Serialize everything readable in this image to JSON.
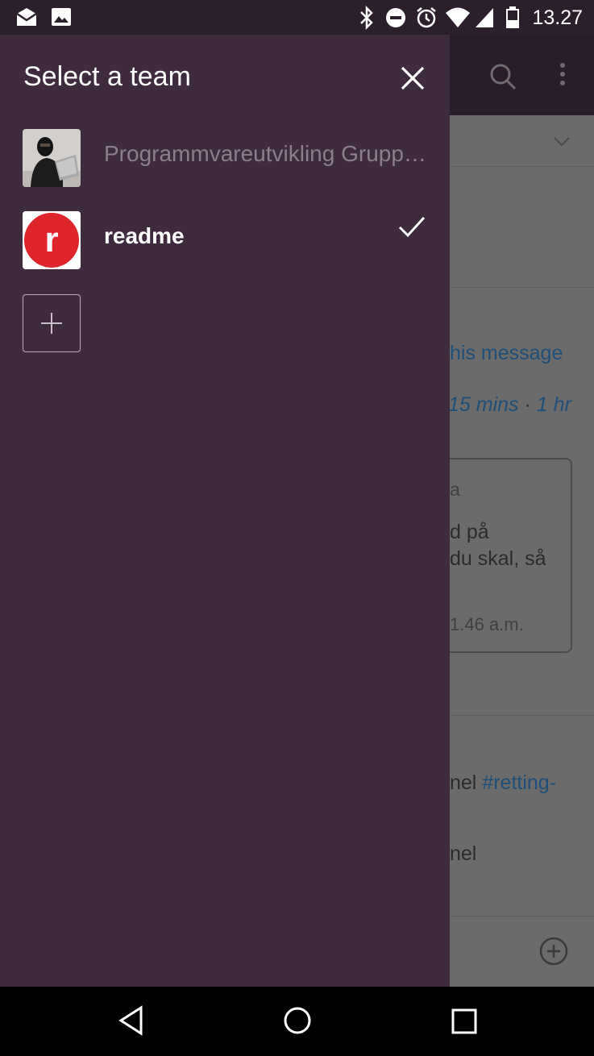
{
  "status_bar": {
    "time": "13.27",
    "left_icons": [
      "mail-icon",
      "image-icon"
    ],
    "right_icons": [
      "bluetooth-icon",
      "do-not-disturb-icon",
      "alarm-icon",
      "wifi-icon",
      "signal-icon",
      "battery-icon"
    ]
  },
  "background_app": {
    "lines": [
      "his message",
      "15 mins",
      " · ",
      "1 hr",
      "a",
      "d på",
      "du skal, så",
      "1.46 a.m.",
      "nel ",
      "#retting-",
      "nel"
    ]
  },
  "drawer": {
    "title": "Select a team",
    "teams": [
      {
        "name": "Programmvareutvikling Grupp…",
        "selected": false
      },
      {
        "name": "readme",
        "selected": true
      }
    ],
    "avatar_letter": "r"
  },
  "colors": {
    "drawer_bg": "#3e2c3e",
    "status_bar_bg": "#2c1f2c",
    "brand_red": "#e0242b",
    "link_blue": "#1d4f7a"
  }
}
